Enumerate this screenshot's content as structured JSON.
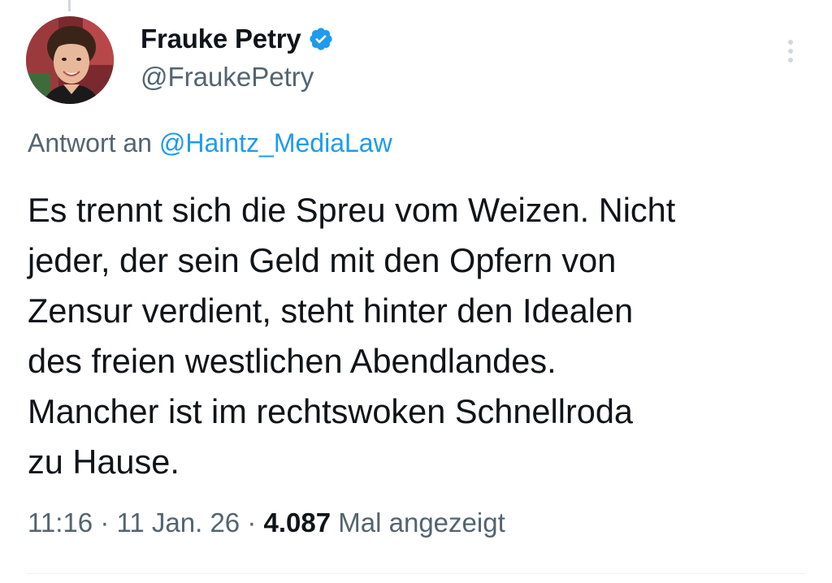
{
  "author": {
    "display_name": "Frauke Petry",
    "handle": "@FraukePetry",
    "verified": true,
    "verified_icon": "verified-badge-icon",
    "verified_color": "#1d9bf0"
  },
  "reply": {
    "prefix": "Antwort an",
    "mention": "@Haintz_MediaLaw"
  },
  "tweet": {
    "lines": [
      "Es trennt sich die Spreu vom Weizen. Nicht",
      "jeder, der sein Geld mit den Opfern von",
      "Zensur verdient, steht hinter den Idealen",
      "des freien westlichen Abendlandes.",
      "Mancher ist im rechtswoken Schnellroda",
      "zu Hause."
    ]
  },
  "meta": {
    "time": "11:16",
    "separator": "·",
    "date": "11 Jan. 26",
    "views_count": "4.087",
    "views_label": "Mal angezeigt"
  },
  "colors": {
    "text": "#0f1419",
    "secondary": "#536471",
    "link": "#1d9bf0"
  }
}
